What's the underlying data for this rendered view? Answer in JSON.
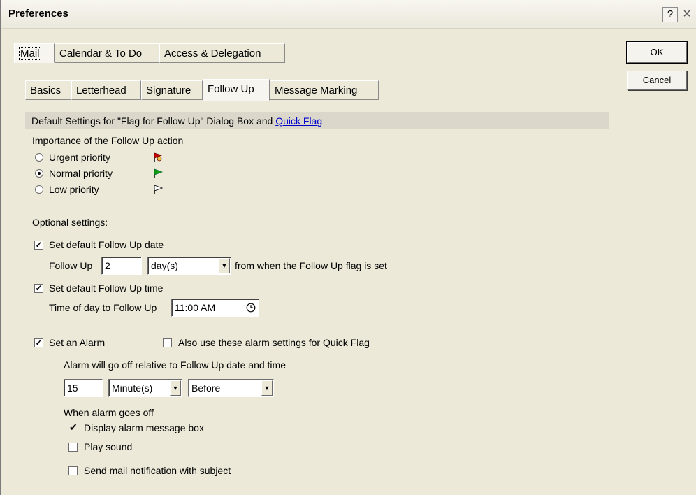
{
  "window": {
    "title": "Preferences",
    "help_glyph": "?",
    "close_glyph": "×"
  },
  "top_tabs": [
    {
      "label": "Mail"
    },
    {
      "label": "Calendar & To Do"
    },
    {
      "label": "Access & Delegation"
    }
  ],
  "sub_tabs": [
    {
      "label": "Basics"
    },
    {
      "label": "Letterhead"
    },
    {
      "label": "Signature"
    },
    {
      "label": "Follow Up"
    },
    {
      "label": "Message Marking"
    }
  ],
  "buttons": {
    "ok": "OK",
    "cancel": "Cancel"
  },
  "section": {
    "text": "Default Settings for \"Flag for Follow Up\" Dialog Box and ",
    "link": "Quick Flag"
  },
  "importance": {
    "label": "Importance of the Follow Up action",
    "options": [
      {
        "label": "Urgent priority",
        "flag_color": "#cc0000"
      },
      {
        "label": "Normal priority",
        "flag_color": "#10a010"
      },
      {
        "label": "Low priority",
        "flag_color": "#ffffff"
      }
    ],
    "selected": "Normal priority"
  },
  "optional_label": "Optional settings:",
  "followup_date": {
    "checkbox": "Set default Follow Up date",
    "checked": true,
    "prefix": "Follow Up",
    "value": "2",
    "unit": "day(s)",
    "suffix": "from when the Follow Up flag is set"
  },
  "followup_time": {
    "checkbox": "Set default Follow Up time",
    "checked": true,
    "label": "Time of day to Follow Up",
    "value": "11:00 AM"
  },
  "alarm": {
    "checkbox": "Set an Alarm",
    "checked": true,
    "quickflag_checkbox": "Also use these alarm settings for Quick Flag",
    "quickflag_checked": false,
    "relative_label": "Alarm will go off relative to Follow Up date and time",
    "amount": "15",
    "unit": "Minute(s)",
    "when": "Before",
    "goes_off_label": "When alarm goes off",
    "display_box": "Display alarm message box",
    "display_checked": true,
    "play_sound": "Play sound",
    "play_sound_checked": false,
    "send_mail": "Send mail notification with subject",
    "send_mail_checked": false
  },
  "glyphs": {
    "check": "✓",
    "dropdown": "▼",
    "tick": "✔"
  }
}
